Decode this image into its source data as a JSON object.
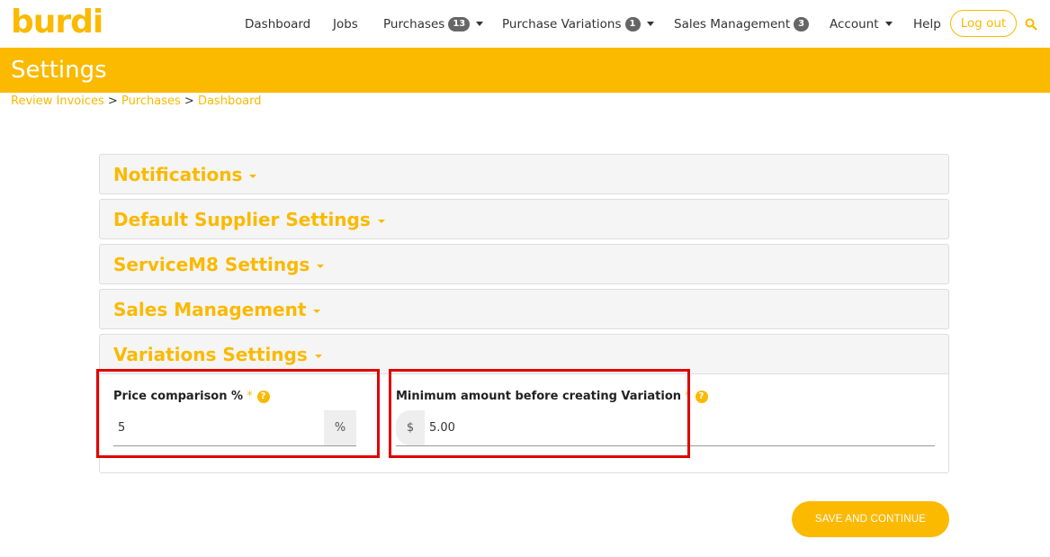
{
  "brand": {
    "logo_text": "burdi",
    "accent": "#fbb900"
  },
  "nav": {
    "dashboard": "Dashboard",
    "jobs": "Jobs",
    "purchases": {
      "label": "Purchases",
      "badge": "13"
    },
    "purchase_variations": {
      "label": "Purchase Variations",
      "badge": "1"
    },
    "sales_management": {
      "label": "Sales Management",
      "badge": "3"
    },
    "account": "Account",
    "help": "Help",
    "logout": "Log out",
    "search_icon": "search-icon"
  },
  "page": {
    "title": "Settings"
  },
  "breadcrumb": {
    "items": [
      "Review Invoices",
      "Purchases",
      "Dashboard"
    ],
    "separator": ">"
  },
  "panels": [
    {
      "title": "Notifications"
    },
    {
      "title": "Default Supplier Settings"
    },
    {
      "title": "ServiceM8 Settings"
    },
    {
      "title": "Sales Management"
    },
    {
      "title": "Variations Settings"
    }
  ],
  "variations": {
    "price_comparison": {
      "label": "Price comparison %",
      "required": "*",
      "value": "5",
      "suffix": "%"
    },
    "minimum_amount": {
      "label": "Minimum amount before creating Variation",
      "required": "*",
      "prefix": "$",
      "value": "5.00"
    }
  },
  "actions": {
    "save": "SAVE AND CONTINUE"
  }
}
